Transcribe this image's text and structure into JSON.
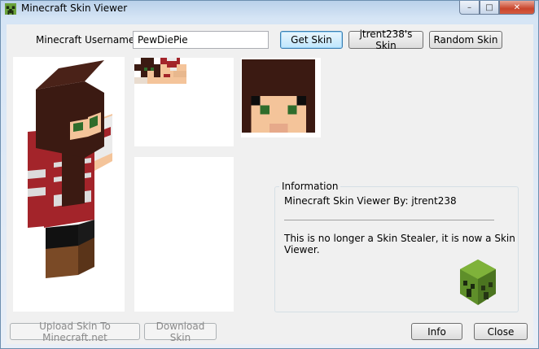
{
  "window": {
    "title": "Minecraft Skin Viewer"
  },
  "titlebar": {
    "minimize": "–",
    "maximize": "□",
    "close": "✕"
  },
  "username": {
    "label": "Minecraft Username:",
    "value": "PewDiePie"
  },
  "buttons": {
    "get_skin": "Get Skin",
    "jtrent_skin": "jtrent238's Skin",
    "random_skin": "Random Skin",
    "upload": "Upload Skin To Minecraft.net",
    "download": "Download Skin",
    "info": "Info",
    "close": "Close"
  },
  "information": {
    "title": "Information",
    "line1": "Minecraft Skin Viewer By: jtrent238",
    "line2": "This is no longer a Skin Stealer, it is now a Skin Viewer."
  },
  "icons": {
    "app": "creeper-head-icon",
    "logo": "creeper-head-icon"
  },
  "colors": {
    "hair": "#3b1a12",
    "shirt": "#a3242a",
    "skin": "#f4c49a",
    "eyes": "#2f6d2c",
    "creeper": "#5f8f2a"
  }
}
